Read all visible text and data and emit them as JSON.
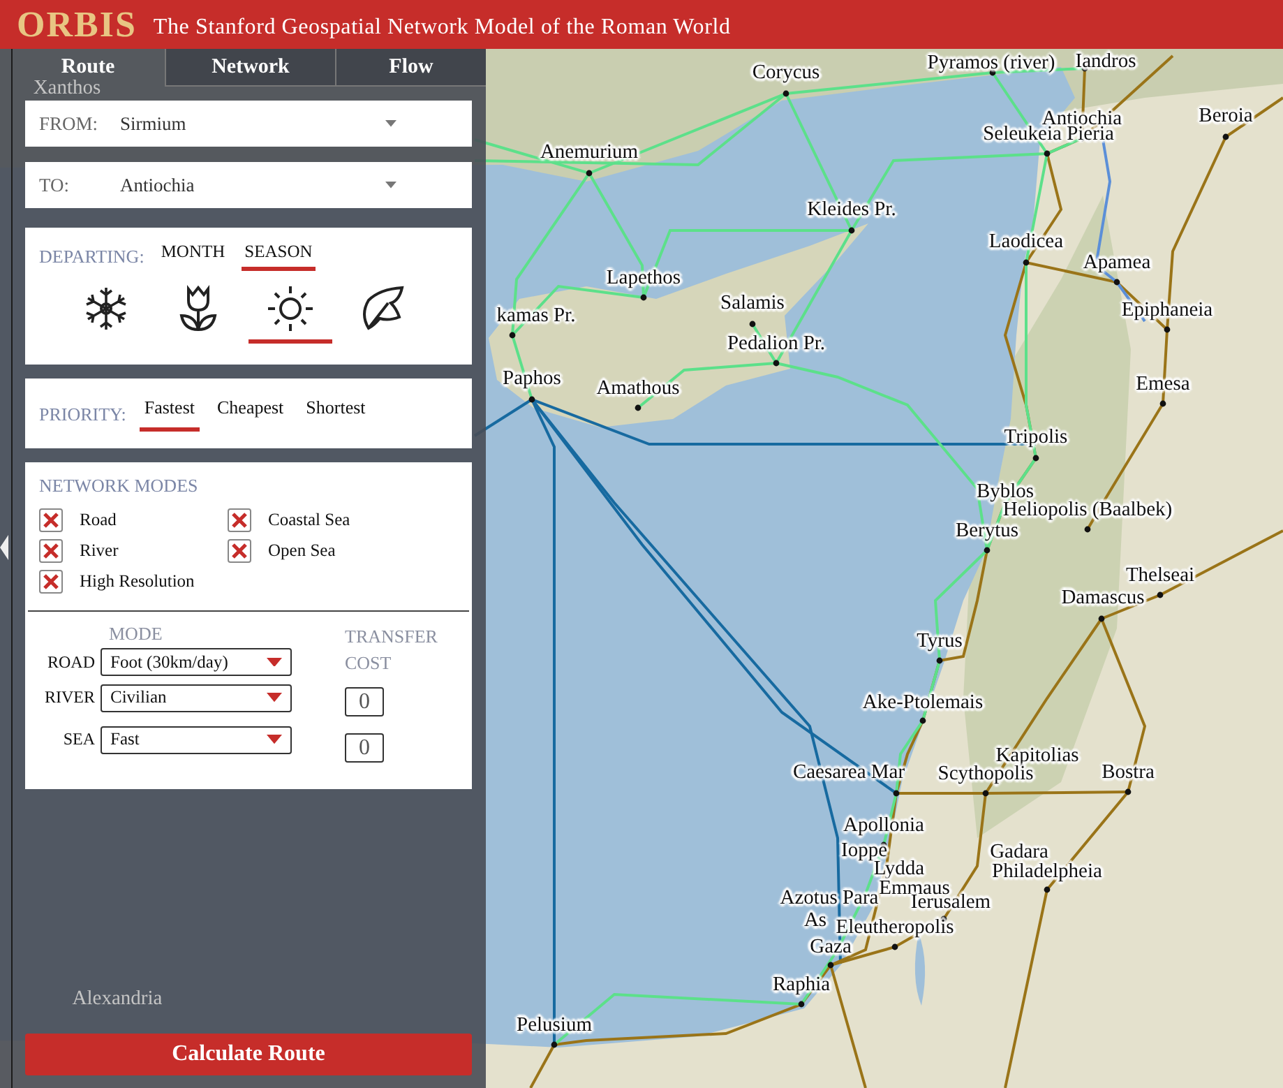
{
  "header": {
    "logo": "ORBIS",
    "subtitle": "The Stanford Geospatial Network Model of the Roman World"
  },
  "tabs": [
    {
      "label": "Route",
      "selected": true
    },
    {
      "label": "Network",
      "selected": false
    },
    {
      "label": "Flow",
      "selected": false
    }
  ],
  "from": {
    "label": "FROM:",
    "value": "Sirmium"
  },
  "to": {
    "label": "TO:",
    "value": "Antiochia"
  },
  "departing": {
    "label": "DEPARTING:",
    "options": [
      {
        "label": "MONTH",
        "selected": false
      },
      {
        "label": "SEASON",
        "selected": true
      }
    ],
    "seasons": [
      {
        "kind": "winter",
        "selected": false
      },
      {
        "kind": "spring",
        "selected": false
      },
      {
        "kind": "summer",
        "selected": true
      },
      {
        "kind": "autumn",
        "selected": false
      }
    ]
  },
  "priority": {
    "label": "PRIORITY:",
    "options": [
      {
        "label": "Fastest",
        "selected": true
      },
      {
        "label": "Cheapest",
        "selected": false
      },
      {
        "label": "Shortest",
        "selected": false
      }
    ]
  },
  "network_modes": {
    "title": "NETWORK MODES",
    "modes": [
      {
        "label": "Road",
        "checked": true
      },
      {
        "label": "Coastal Sea",
        "checked": true
      },
      {
        "label": "River",
        "checked": true
      },
      {
        "label": "Open Sea",
        "checked": true
      },
      {
        "label": "High Resolution",
        "checked": true
      }
    ],
    "mode_header": "MODE",
    "transfer_header": "TRANSFER COST",
    "rows": [
      {
        "label": "ROAD",
        "value": "Foot (30km/day)"
      },
      {
        "label": "RIVER",
        "value": "Civilian",
        "transfer": "0"
      },
      {
        "label": "SEA",
        "value": "Fast",
        "transfer": "0"
      }
    ]
  },
  "calculate_button": "Calculate Route",
  "map": {
    "places": [
      "Corycus",
      "Pyramos (river)",
      "Iandros",
      "Anemurium",
      "Antiochia",
      "Seleukeia Pieria",
      "Beroia",
      "Kleides Pr.",
      "Laodicea",
      "Apamea",
      "Lapethos",
      "Salamis",
      "kamas Pr.",
      "Epiphaneia",
      "Paphos",
      "Pedalion Pr.",
      "Amathous",
      "Emesa",
      "Tripolis",
      "Byblos",
      "Heliopolis (Baalbek)",
      "Berytus",
      "Thelseai",
      "Damascus",
      "Tyrus",
      "Ake-Ptolemais",
      "Kapitolias",
      "Caesarea Mar",
      "Scythopolis",
      "Bostra",
      "Apollonia",
      "Ioppe",
      "Gadara",
      "Lydda",
      "Philadelpheia",
      "Emmaus",
      "Azotus Para",
      "Ierusalem",
      "As",
      "Eleutheropolis",
      "Gaza",
      "Raphia",
      "Pelusium"
    ],
    "background_places": [
      "Xanthos",
      "Alexandria"
    ]
  }
}
